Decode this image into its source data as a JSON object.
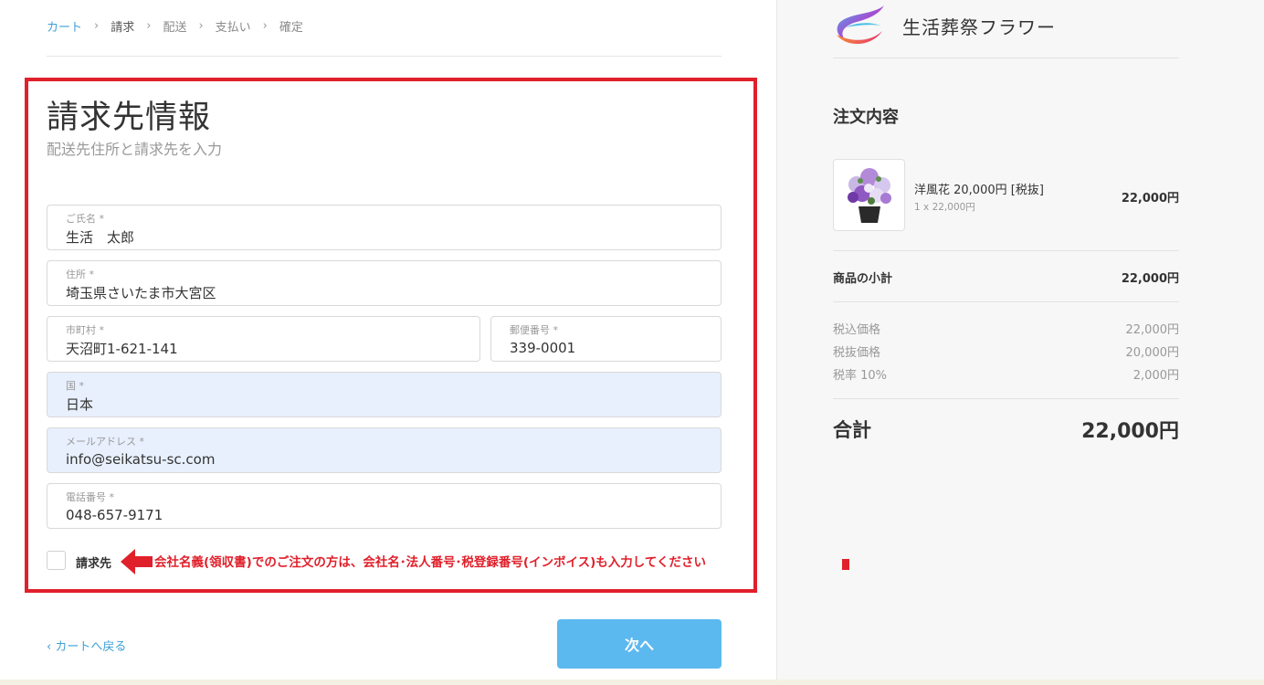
{
  "breadcrumb": {
    "items": [
      {
        "label": "カート",
        "state": "link"
      },
      {
        "label": "請求",
        "state": "current"
      },
      {
        "label": "配送",
        "state": "muted"
      },
      {
        "label": "支払い",
        "state": "muted"
      },
      {
        "label": "確定",
        "state": "muted"
      }
    ],
    "separator": "›"
  },
  "form": {
    "title": "請求先情報",
    "subtitle": "配送先住所と請求先を入力",
    "fields": {
      "name": {
        "label": "ご氏名 *",
        "value": "生活　太郎"
      },
      "address": {
        "label": "住所 *",
        "value": "埼玉県さいたま市大宮区"
      },
      "city": {
        "label": "市町村 *",
        "value": "天沼町1-621-141"
      },
      "postal": {
        "label": "郵便番号 *",
        "value": "339-0001"
      },
      "country": {
        "label": "国 *",
        "value": "日本"
      },
      "email": {
        "label": "メールアドレス *",
        "value": "info@seikatsu-sc.com"
      },
      "phone": {
        "label": "電話番号 *",
        "value": "048-657-9171"
      }
    },
    "billing_checkbox_label": "請求先",
    "note": "会社名義(領収書)でのご注文の方は、会社名･法人番号･税登録番号(インボイス)も入力してください"
  },
  "nav": {
    "back_label": "‹  カートへ戻る",
    "next_label": "次へ"
  },
  "summary": {
    "brand": "生活葬祭フラワー",
    "title": "注文内容",
    "item": {
      "name": "洋風花 20,000円 [税抜]",
      "qty_line": "1 x 22,000円",
      "price": "22,000円"
    },
    "subtotal_label": "商品の小計",
    "subtotal_value": "22,000円",
    "tax_rows": [
      {
        "label": "税込価格",
        "value": "22,000円"
      },
      {
        "label": "税抜価格",
        "value": "20,000円"
      },
      {
        "label": "税率 10%",
        "value": "2,000円"
      }
    ],
    "total_label": "合計",
    "total_value": "22,000円"
  },
  "colors": {
    "accent": "#3f9fd7",
    "button": "#5cb9ef",
    "highlight": "#e0202b",
    "autofill": "#e8f0fe"
  },
  "icons": {
    "arrow": "arrow-left-icon",
    "logo": "brand-logo-icon"
  }
}
